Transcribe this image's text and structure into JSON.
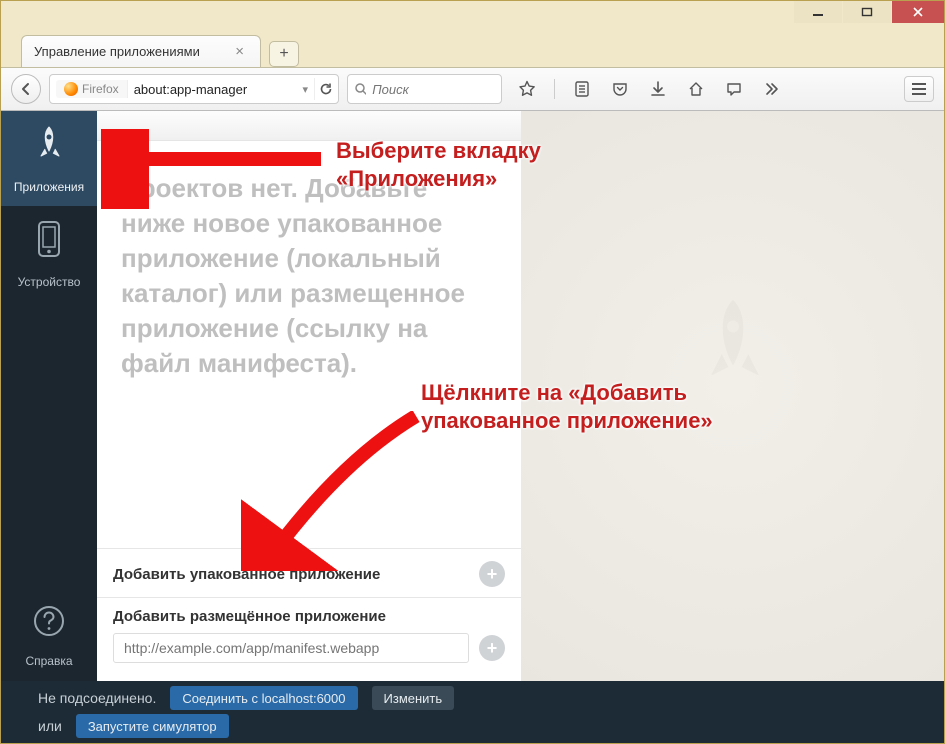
{
  "window": {
    "tab_title": "Управление приложениями"
  },
  "toolbar": {
    "identity": "Firefox",
    "url": "about:app-manager",
    "search_placeholder": "Поиск"
  },
  "sidenav": {
    "apps": "Приложения",
    "device": "Устройство",
    "help": "Справка"
  },
  "apps_panel": {
    "empty_message": "Проектов нет. Добавьте ниже новое упакованное приложение (локальный каталог) или размещенное приложение (ссылку на файл манифеста).",
    "add_packaged_label": "Добавить упакованное приложение",
    "add_hosted_label": "Добавить размещённое приложение",
    "hosted_placeholder": "http://example.com/app/manifest.webapp"
  },
  "status": {
    "disconnected": "Не подсоединено.",
    "connect_label": "Соединить с localhost:6000",
    "change_label": "Изменить",
    "or_label": "или",
    "simulator_label": "Запустите симулятор"
  },
  "annotations": {
    "line1a": "Выберите вкладку",
    "line1b": "«Приложения»",
    "line2a": "Щёлкните на «Добавить",
    "line2b": "упакованное приложение»"
  }
}
